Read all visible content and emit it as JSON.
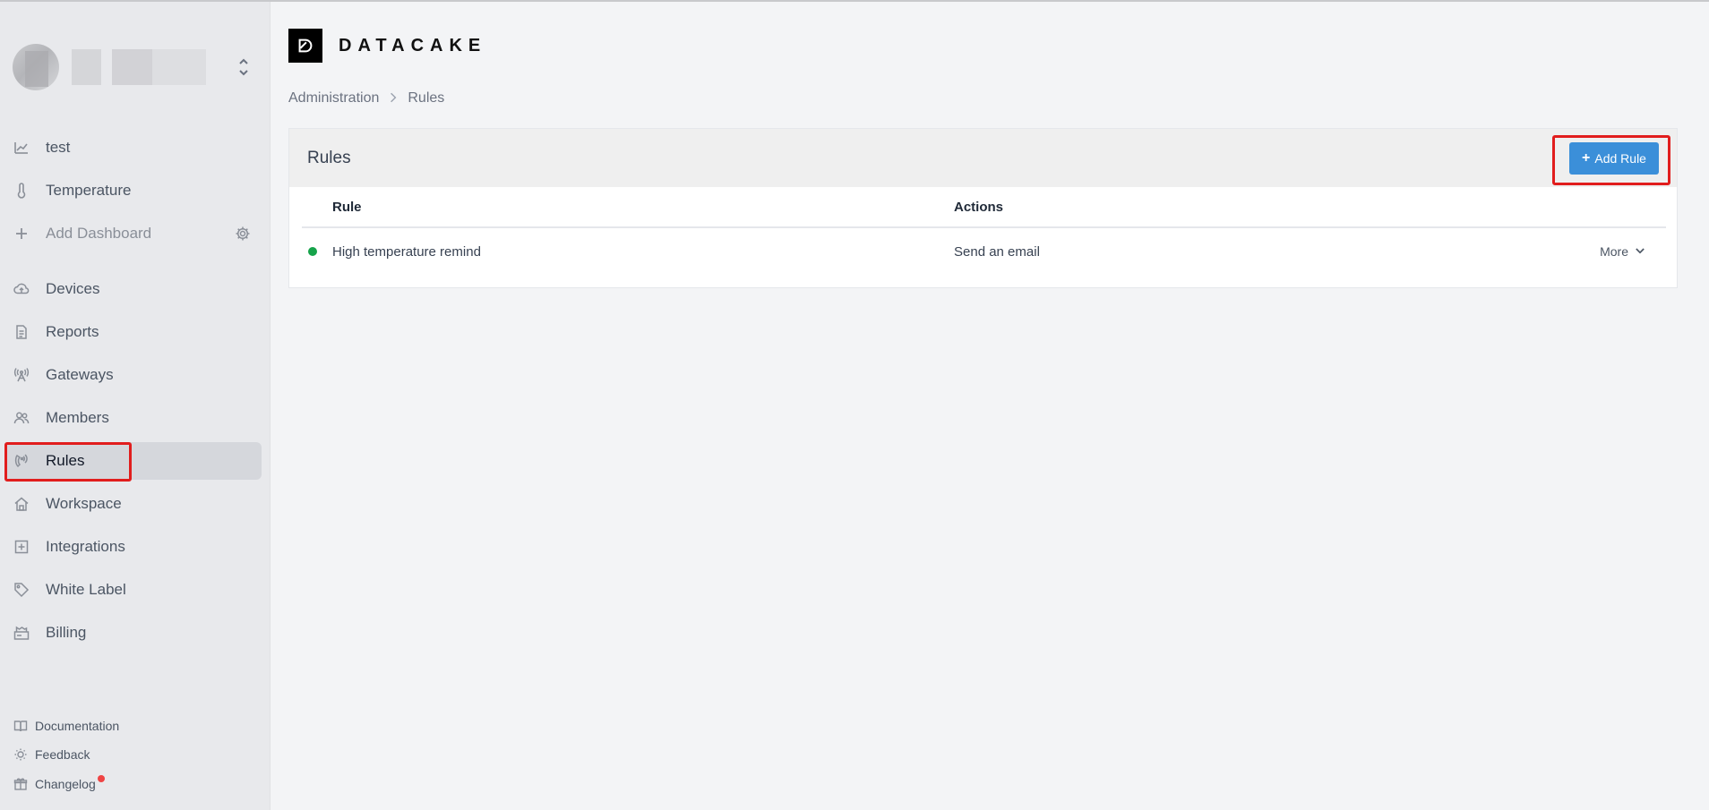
{
  "sidebar": {
    "dashboards": [
      {
        "label": "test",
        "icon": "chart-line-icon"
      },
      {
        "label": "Temperature",
        "icon": "thermometer-icon"
      }
    ],
    "add_dashboard": {
      "label": "Add Dashboard",
      "icon": "plus-icon"
    },
    "nav": [
      {
        "label": "Devices",
        "icon": "cloud-upload-icon"
      },
      {
        "label": "Reports",
        "icon": "document-icon"
      },
      {
        "label": "Gateways",
        "icon": "antenna-icon"
      },
      {
        "label": "Members",
        "icon": "users-icon"
      },
      {
        "label": "Rules",
        "icon": "rules-icon",
        "active": true
      },
      {
        "label": "Workspace",
        "icon": "home-icon"
      },
      {
        "label": "Integrations",
        "icon": "plus-square-icon"
      },
      {
        "label": "White Label",
        "icon": "tag-icon"
      },
      {
        "label": "Billing",
        "icon": "billing-icon"
      }
    ],
    "footer": [
      {
        "label": "Documentation",
        "icon": "book-icon"
      },
      {
        "label": "Feedback",
        "icon": "lightbulb-icon"
      },
      {
        "label": "Changelog",
        "icon": "gift-icon"
      }
    ]
  },
  "header": {
    "logo_text": "DATACAKE"
  },
  "breadcrumb": {
    "root": "Administration",
    "current": "Rules"
  },
  "card": {
    "title": "Rules",
    "add_button": "Add Rule",
    "columns": [
      "Rule",
      "Actions"
    ],
    "rows": [
      {
        "rule": "High temperature remind",
        "action": "Send an email",
        "status_color": "#16a34a",
        "more": "More"
      }
    ]
  },
  "colors": {
    "accent": "#3b8fd9",
    "highlight": "#e11d1d",
    "status_active": "#16a34a"
  }
}
